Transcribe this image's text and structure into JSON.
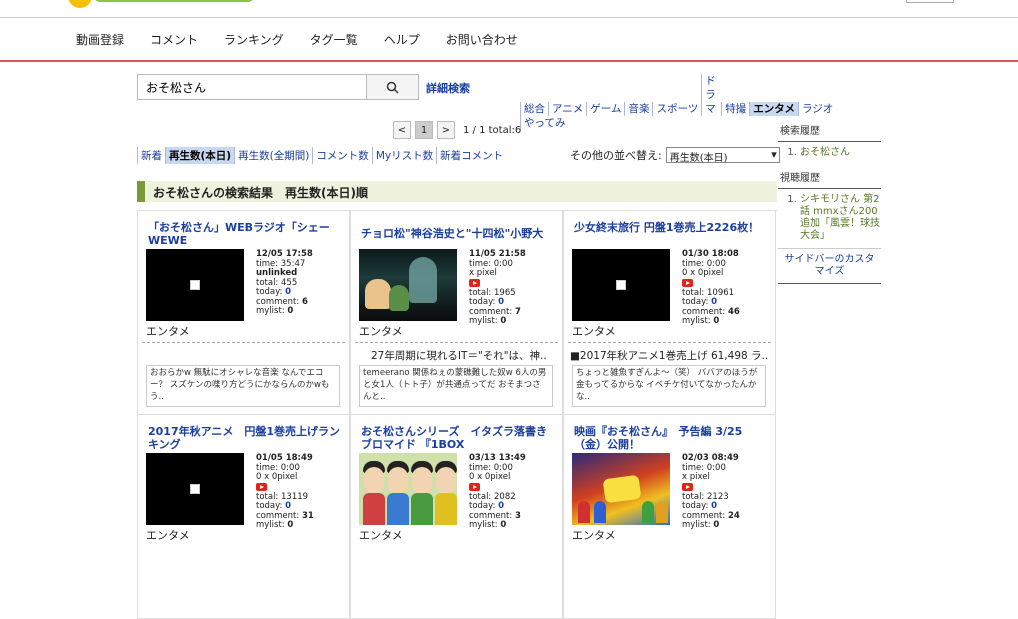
{
  "nav": {
    "items": [
      "動画登録",
      "コメント",
      "ランキング",
      "タグ一覧",
      "ヘルプ",
      "お問い合わせ"
    ]
  },
  "search": {
    "value": "おそ松さん",
    "advanced_label": "詳細検索"
  },
  "categories": [
    "総合",
    "アニメ",
    "ゲーム",
    "音楽",
    "スポーツ",
    "ドラマ",
    "特撮",
    "エンタメ",
    "ラジオ",
    "やってみ"
  ],
  "categories_active": "エンタメ",
  "pager": {
    "prev": "<",
    "current": "1",
    "next": ">",
    "text": "1 / 1 total:6"
  },
  "sort_tabs": [
    "新着",
    "再生数(本日)",
    "再生数(全期間)",
    "コメント数",
    "Myリスト数",
    "新着コメント"
  ],
  "sort_active": "再生数(本日)",
  "other_sort": {
    "label": "その他の並べ替え:",
    "value": "再生数(本日)"
  },
  "result_heading": "おそ松さんの検索結果　再生数(本日)順",
  "videos": [
    {
      "title": "「おそ松さん」WEBラジオ「シェーWEWE",
      "date": "12/05 17:58",
      "l1": "time: 35:47",
      "l2": "unlinked",
      "total": "455",
      "today": "0",
      "comment": "6",
      "mylist": "0",
      "genre": "エンタメ",
      "headline": "",
      "desc": "おおらかw 無駄にオシャレな音楽 なんでエコー？ スズケンの喋り方どうにかならんのかwもう..",
      "yt": false
    },
    {
      "title": "チョロ松\"神谷浩史と\"十四松\"小野大",
      "date": "11/05 21:58",
      "l1": "time: 0:00",
      "l2": "x pixel",
      "total": "1965",
      "today": "0",
      "comment": "7",
      "mylist": "0",
      "genre": "エンタメ",
      "headline": "27年周期に現れるIT＝\"それ\"は、神..",
      "desc": "temeerano 関係ねぇの蒙礁難した奴w 6人の男と女1人（トト子）が共通点ってだ おそまつさんと..",
      "yt": true
    },
    {
      "title": "少女終末旅行 円盤1巻売上2226枚！",
      "date": "01/30 18:08",
      "l1": "time: 0:00",
      "l2": "0 x 0pixel",
      "total": "10961",
      "today": "0",
      "comment": "46",
      "mylist": "0",
      "genre": "エンタメ",
      "headline": "■2017年秋アニメ1巻売上げ 61,498 ラ..",
      "desc": "ちょっと雑魚すぎんよ～（笑） ババアのほうが金もってるからな イベチケ付いてなかったんかな..",
      "yt": true
    },
    {
      "title": "2017年秋アニメ　円盤1巻売上げランキング",
      "date": "01/05 18:49",
      "l1": "time: 0:00",
      "l2": "0 x 0pixel",
      "total": "13119",
      "today": "0",
      "comment": "31",
      "mylist": "0",
      "genre": "エンタメ",
      "headline": "",
      "desc": "",
      "yt": true
    },
    {
      "title": "おそ松さんシリーズ　イタズラ落書きブロマイド 『1BOX",
      "date": "03/13 13:49",
      "l1": "time: 0:00",
      "l2": "0 x 0pixel",
      "total": "2082",
      "today": "0",
      "comment": "3",
      "mylist": "0",
      "genre": "エンタメ",
      "headline": "",
      "desc": "",
      "yt": true
    },
    {
      "title": "映画『おそ松さん』　予告編 3/25（金）公開！",
      "date": "02/03 08:49",
      "l1": "time: 0:00",
      "l2": "x pixel",
      "total": "2123",
      "today": "0",
      "comment": "24",
      "mylist": "0",
      "genre": "エンタメ",
      "headline": "",
      "desc": "",
      "yt": true
    }
  ],
  "sidebar": {
    "search_history_title": "検索履歴",
    "search_history": [
      "おそ松さん"
    ],
    "view_history_title": "視聴履歴",
    "view_history": [
      "シキモリさん 第2話 mmxさん200追加「風雲！球技大会」"
    ],
    "customize": "サイドバーのカスタマイズ"
  }
}
